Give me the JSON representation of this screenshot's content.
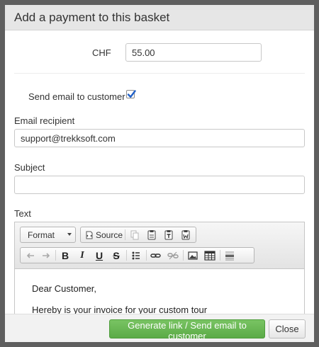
{
  "modal": {
    "title": "Add a payment to this basket"
  },
  "amount": {
    "currency": "CHF",
    "value": "55.00"
  },
  "send_email": {
    "label": "Send email to customer",
    "checked": true
  },
  "email": {
    "label": "Email recipient",
    "value": "support@trekksoft.com"
  },
  "subject": {
    "label": "Subject",
    "value": ""
  },
  "text": {
    "label": "Text",
    "toolbar": {
      "format_label": "Format",
      "source_label": "Source",
      "bold": "B",
      "italic": "I",
      "underline": "U",
      "strike": "S"
    },
    "content": {
      "line1": "Dear Customer,",
      "line2": "Hereby is your invoice for your custom tour"
    }
  },
  "footer": {
    "generate_label": "Generate link / Send email to customer",
    "close_label": "Close"
  },
  "colors": {
    "primary": "#5bab47",
    "overlay": "#5f5f5f",
    "header": "#e6e6e6",
    "checkbox": "#2060c8"
  }
}
